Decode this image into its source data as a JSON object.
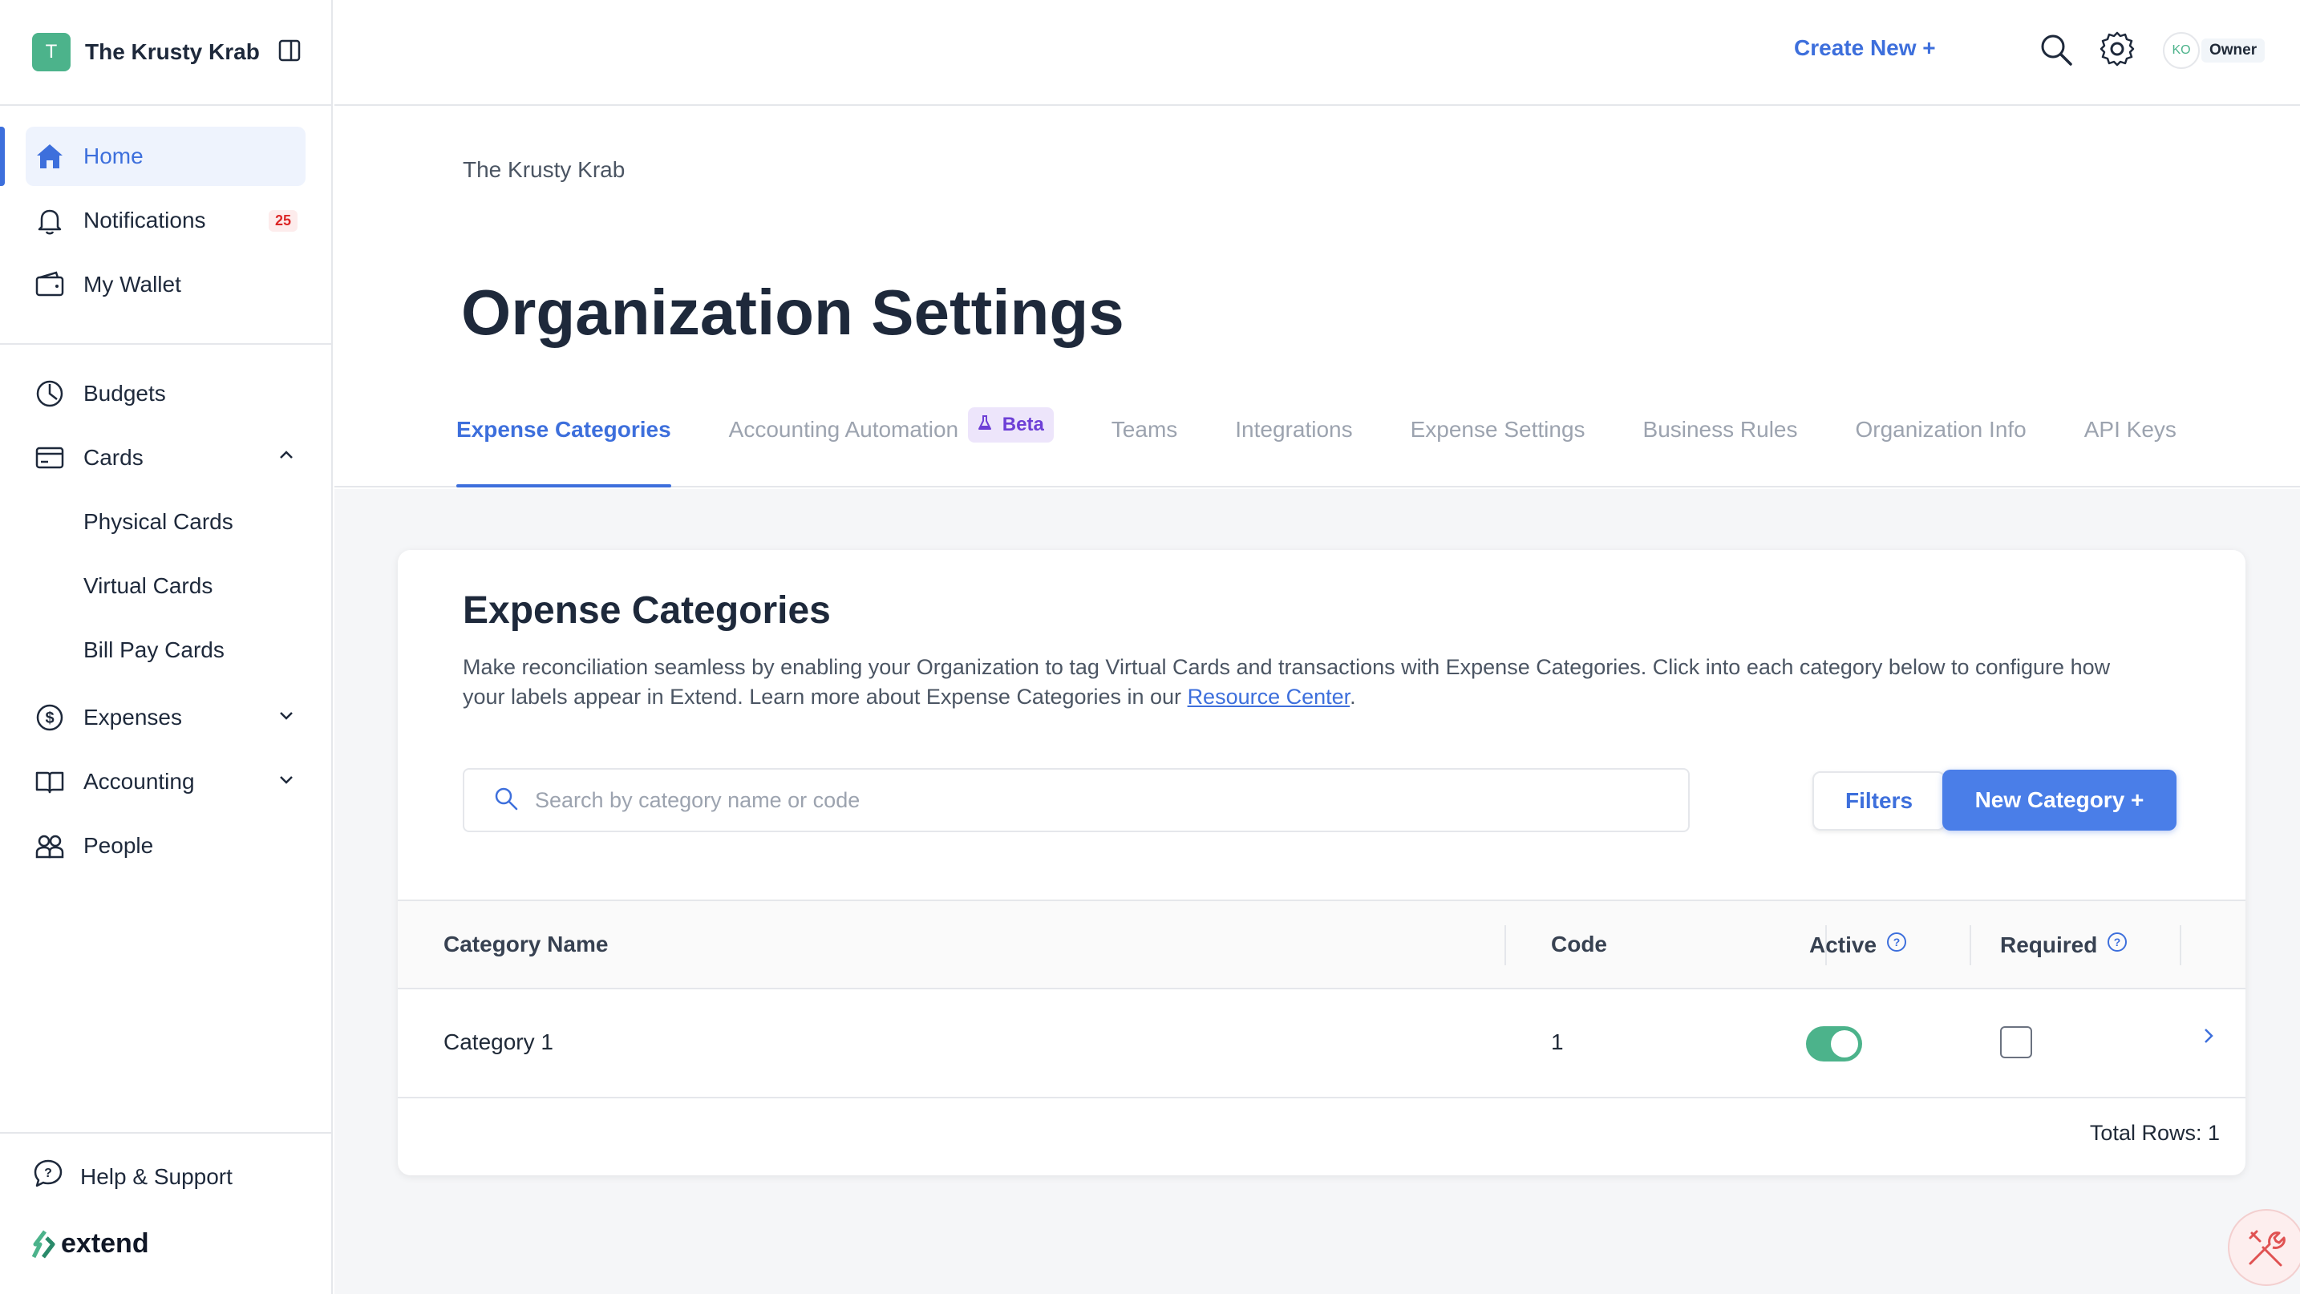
{
  "org": {
    "initial": "T",
    "name": "The Krusty Krab"
  },
  "sidebar": {
    "primary": [
      {
        "label": "Home",
        "icon": "home-icon"
      },
      {
        "label": "Notifications",
        "icon": "bell-icon",
        "badge": "25"
      },
      {
        "label": "My Wallet",
        "icon": "wallet-icon"
      }
    ],
    "secondary": [
      {
        "label": "Budgets",
        "icon": "budget-icon"
      },
      {
        "label": "Cards",
        "icon": "card-icon"
      },
      {
        "label": "Physical Cards"
      },
      {
        "label": "Virtual Cards"
      },
      {
        "label": "Bill Pay Cards"
      },
      {
        "label": "Expenses",
        "icon": "dollar-icon"
      },
      {
        "label": "Accounting",
        "icon": "book-icon"
      },
      {
        "label": "People",
        "icon": "people-icon"
      }
    ],
    "footer": {
      "help": "Help & Support",
      "brand": "extend"
    }
  },
  "topbar": {
    "create_new": "Create New +",
    "user_initials": "KO",
    "role": "Owner"
  },
  "header": {
    "breadcrumb": "The Krusty Krab",
    "title": "Organization Settings",
    "tabs": [
      {
        "label": "Expense Categories"
      },
      {
        "label": "Accounting Automation",
        "badge": "Beta"
      },
      {
        "label": "Teams"
      },
      {
        "label": "Integrations"
      },
      {
        "label": "Expense Settings"
      },
      {
        "label": "Business Rules"
      },
      {
        "label": "Organization Info"
      },
      {
        "label": "API Keys"
      }
    ]
  },
  "card": {
    "title": "Expense Categories",
    "desc_text": "Make reconciliation seamless by enabling your Organization to tag Virtual Cards and transactions with Expense Categories. Click into each category below to configure how your labels appear in Extend. Learn more about Expense Categories in our ",
    "desc_link": "Resource Center",
    "desc_end": ".",
    "search_placeholder": "Search by category name or code",
    "filters": "Filters",
    "new_category": "New Category +",
    "columns": {
      "name": "Category Name",
      "code": "Code",
      "active": "Active",
      "required": "Required"
    },
    "rows": [
      {
        "name": "Category 1",
        "code": "1",
        "active": true,
        "required": false
      }
    ],
    "total_rows": "Total Rows: 1"
  },
  "colors": {
    "accent": "#3d6fdc",
    "brand_green": "#4cb38b",
    "beta": "#6d3fd6"
  }
}
